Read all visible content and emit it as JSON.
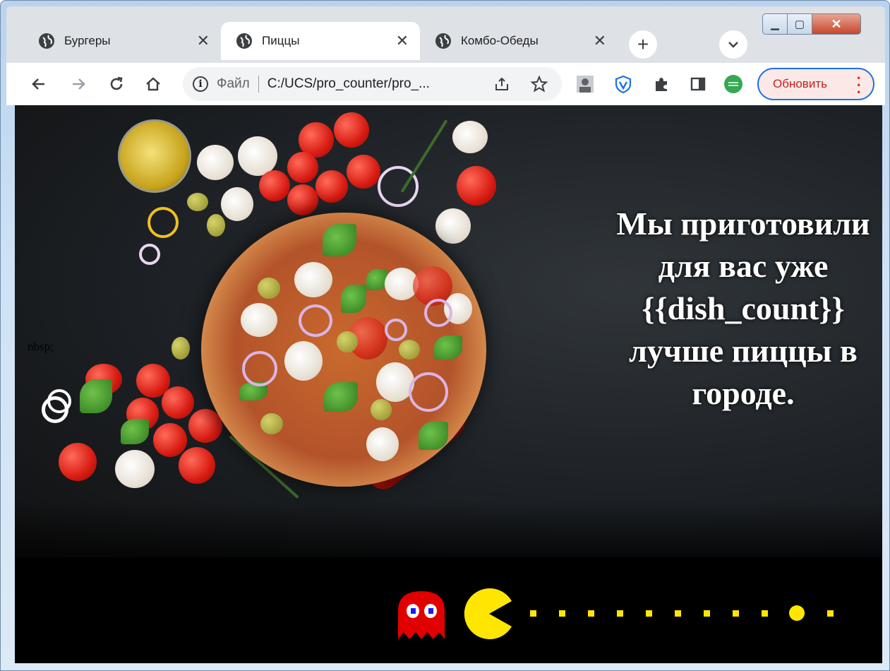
{
  "browser": {
    "tabs": [
      {
        "label": "Бургеры",
        "active": false
      },
      {
        "label": "Пиццы",
        "active": true
      },
      {
        "label": "Комбо-Обеды",
        "active": false
      }
    ],
    "new_tab_label": "+",
    "address": {
      "file_label": "Файл",
      "url": "C:/UCS/pro_counter/pro_..."
    },
    "update_button_label": "Обновить"
  },
  "page": {
    "stray_text": "nbsp;",
    "headline": "Мы приготовили для вас уже {{dish_count}} лучше пиццы в городе."
  },
  "colors": {
    "update_border": "#1a73e8",
    "update_text": "#c5221f",
    "pacman": "#ffe600",
    "ghost": "#e00000"
  }
}
